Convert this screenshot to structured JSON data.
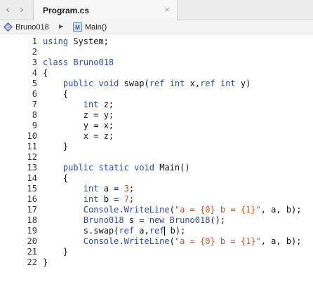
{
  "tab": {
    "title": "Program.cs",
    "close_glyph": "×"
  },
  "nav": {
    "back_glyph": "‹",
    "forward_glyph": "›"
  },
  "breadcrumb": {
    "class_icon_letter": "C",
    "class_name": "Bruno018",
    "separator_glyph": "▶",
    "method_icon_letter": "M",
    "method_name": "Main()"
  },
  "colors": {
    "keyword": "#2d49b3",
    "string": "#d6521f",
    "number": "#d6521f"
  },
  "code_lines": [
    {
      "n": "1",
      "tokens": [
        [
          "kw",
          "using"
        ],
        [
          "pl",
          " System;"
        ]
      ]
    },
    {
      "n": "2",
      "tokens": []
    },
    {
      "n": "3",
      "tokens": [
        [
          "kw",
          "class"
        ],
        [
          "pl",
          " "
        ],
        [
          "kw",
          "Bruno018"
        ]
      ]
    },
    {
      "n": "4",
      "tokens": [
        [
          "pl",
          "{"
        ]
      ]
    },
    {
      "n": "5",
      "tokens": [
        [
          "pl",
          "    "
        ],
        [
          "kw",
          "public"
        ],
        [
          "pl",
          " "
        ],
        [
          "kw",
          "void"
        ],
        [
          "pl",
          " swap("
        ],
        [
          "kw",
          "ref"
        ],
        [
          "pl",
          " "
        ],
        [
          "kw",
          "int"
        ],
        [
          "pl",
          " x,"
        ],
        [
          "kw",
          "ref"
        ],
        [
          "pl",
          " "
        ],
        [
          "kw",
          "int"
        ],
        [
          "pl",
          " y)"
        ]
      ]
    },
    {
      "n": "6",
      "tokens": [
        [
          "pl",
          "    {"
        ]
      ]
    },
    {
      "n": "7",
      "tokens": [
        [
          "pl",
          "        "
        ],
        [
          "kw",
          "int"
        ],
        [
          "pl",
          " z;"
        ]
      ]
    },
    {
      "n": "8",
      "tokens": [
        [
          "pl",
          "        z = y;"
        ]
      ]
    },
    {
      "n": "9",
      "tokens": [
        [
          "pl",
          "        y = x;"
        ]
      ]
    },
    {
      "n": "10",
      "tokens": [
        [
          "pl",
          "        x = z;"
        ]
      ]
    },
    {
      "n": "11",
      "tokens": [
        [
          "pl",
          "    }"
        ]
      ]
    },
    {
      "n": "12",
      "tokens": []
    },
    {
      "n": "13",
      "tokens": [
        [
          "pl",
          "    "
        ],
        [
          "kw",
          "public"
        ],
        [
          "pl",
          " "
        ],
        [
          "kw",
          "static"
        ],
        [
          "pl",
          " "
        ],
        [
          "kw",
          "void"
        ],
        [
          "pl",
          " Main()"
        ]
      ]
    },
    {
      "n": "14",
      "tokens": [
        [
          "pl",
          "    {"
        ]
      ]
    },
    {
      "n": "15",
      "tokens": [
        [
          "pl",
          "        "
        ],
        [
          "kw",
          "int"
        ],
        [
          "pl",
          " a = "
        ],
        [
          "num",
          "3"
        ],
        [
          "pl",
          ";"
        ]
      ]
    },
    {
      "n": "16",
      "tokens": [
        [
          "pl",
          "        "
        ],
        [
          "kw",
          "int"
        ],
        [
          "pl",
          " b = "
        ],
        [
          "num",
          "7"
        ],
        [
          "pl",
          ";"
        ]
      ]
    },
    {
      "n": "17",
      "tokens": [
        [
          "pl",
          "        "
        ],
        [
          "kw",
          "Console"
        ],
        [
          "pl",
          "."
        ],
        [
          "kw",
          "WriteLine"
        ],
        [
          "pl",
          "("
        ],
        [
          "str",
          "\"a = {0} b = {1}\""
        ],
        [
          "pl",
          ", a, b);"
        ]
      ]
    },
    {
      "n": "18",
      "tokens": [
        [
          "pl",
          "        "
        ],
        [
          "kw",
          "Bruno018"
        ],
        [
          "pl",
          " s = "
        ],
        [
          "kw",
          "new"
        ],
        [
          "pl",
          " "
        ],
        [
          "kw",
          "Bruno018"
        ],
        [
          "pl",
          "();"
        ]
      ]
    },
    {
      "n": "19",
      "tokens": [
        [
          "pl",
          "        s.swap("
        ],
        [
          "kw",
          "ref"
        ],
        [
          "pl",
          " a,"
        ],
        [
          "kw",
          "ref"
        ],
        [
          "caret",
          ""
        ],
        [
          "pl",
          " b);"
        ]
      ]
    },
    {
      "n": "20",
      "tokens": [
        [
          "pl",
          "        "
        ],
        [
          "kw",
          "Console"
        ],
        [
          "pl",
          "."
        ],
        [
          "kw",
          "WriteLine"
        ],
        [
          "pl",
          "("
        ],
        [
          "str",
          "\"a = {0} b = {1}\""
        ],
        [
          "pl",
          ", a, b);"
        ]
      ]
    },
    {
      "n": "21",
      "tokens": [
        [
          "pl",
          "    }"
        ]
      ]
    },
    {
      "n": "22",
      "tokens": [
        [
          "pl",
          "}"
        ]
      ]
    }
  ]
}
